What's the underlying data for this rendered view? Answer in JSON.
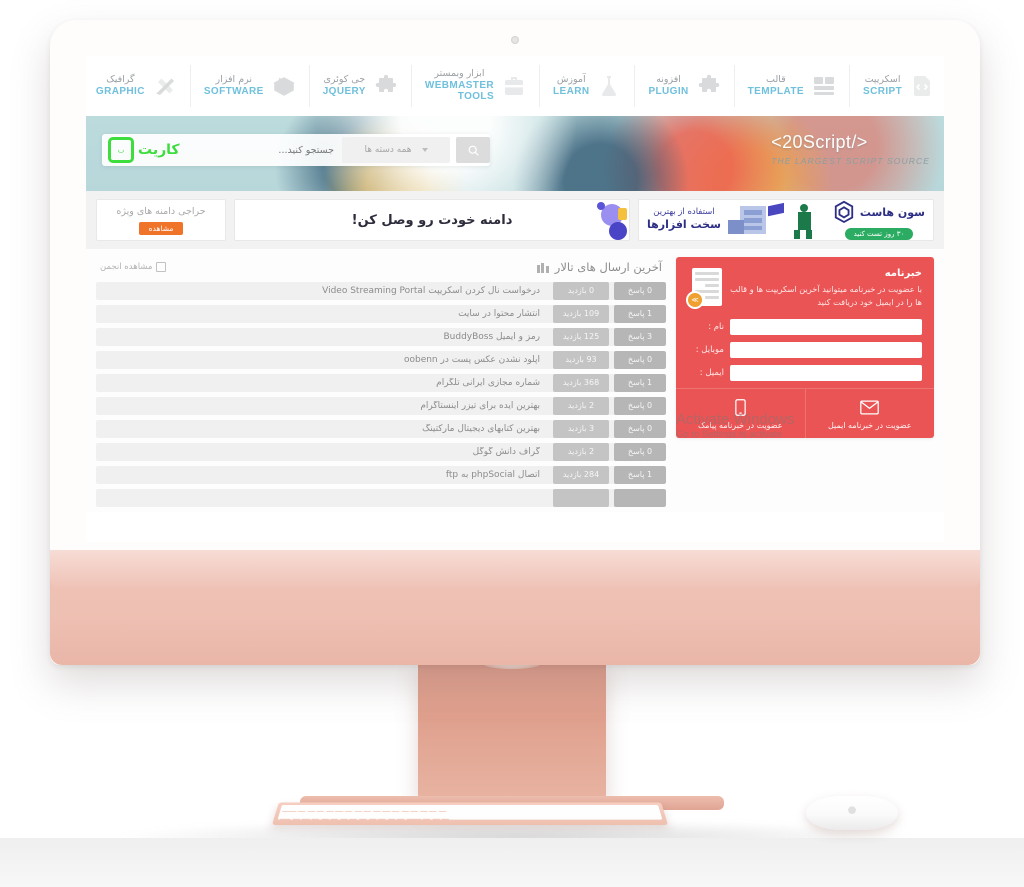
{
  "site": {
    "nav": [
      {
        "fa": "اسکریپت",
        "en": "SCRIPT",
        "icon": "script-icon"
      },
      {
        "fa": "قالب",
        "en": "TEMPLATE",
        "icon": "template-icon"
      },
      {
        "fa": "افزونه",
        "en": "PLUGIN",
        "icon": "plugin-icon"
      },
      {
        "fa": "آموزش",
        "en": "LEARN",
        "icon": "flask-icon"
      },
      {
        "fa": "ابزار وبمستر",
        "en": "WEBMASTER TOOLS",
        "icon": "toolbox-icon"
      },
      {
        "fa": "جی کوئری",
        "en": "JQUERY",
        "icon": "puzzle-icon"
      },
      {
        "fa": "نرم افزار",
        "en": "SOFTWARE",
        "icon": "box-icon"
      },
      {
        "fa": "گرافیک",
        "en": "GRAPHIC",
        "icon": "pencil-ruler-icon"
      }
    ],
    "hero": {
      "title": "<20Script/>",
      "subtitle": "THE LARGEST SCRIPT SOURCE",
      "logo_text": "کاریت",
      "search_placeholder": "جستجو کنید...",
      "category_label": "همه دسته ها"
    },
    "ads": {
      "domain_sale_text": "حراجی دامنه های ویژه",
      "domain_sale_button": "مشاهده",
      "connect_text": "دامنه خودت رو وصل کن!",
      "host_name": "سون هاست",
      "host_button": "۳۰ روز تست کنید",
      "host_line1": "استفاده از بهترین",
      "host_line2": "سخت افزارها"
    },
    "forum": {
      "title": "آخرین ارسال های تالار",
      "view_link": "مشاهده انجمن",
      "views_suffix": "بازدید",
      "replies_suffix": "پاسخ",
      "rows": [
        {
          "title": "درخواست نال کردن اسکریپت Video Streaming Portal",
          "views": "0 بازدید",
          "replies": "0 پاسخ"
        },
        {
          "title": "انتشار محتوا در سایت",
          "views": "109 بازدید",
          "replies": "1 پاسخ"
        },
        {
          "title": "رمز و ایمیل BuddyBoss",
          "views": "125 بازدید",
          "replies": "3 پاسخ"
        },
        {
          "title": "آپلود نشدن عکس پست در oobenn",
          "views": "93 بازدید",
          "replies": "0 پاسخ"
        },
        {
          "title": "شماره مجازی ایرانی تلگرام",
          "views": "368 بازدید",
          "replies": "1 پاسخ"
        },
        {
          "title": "بهترین ایده برای تیزر اینستاگرام",
          "views": "2 بازدید",
          "replies": "0 پاسخ"
        },
        {
          "title": "بهترین کتابهای دیجیتال مارکتینگ",
          "views": "3 بازدید",
          "replies": "0 پاسخ"
        },
        {
          "title": "گراف دانش گوگل",
          "views": "2 بازدید",
          "replies": "0 پاسخ"
        },
        {
          "title": "اتصال phpSocial به ftp",
          "views": "284 بازدید",
          "replies": "1 پاسخ"
        },
        {
          "title": "",
          "views": "",
          "replies": ""
        }
      ]
    },
    "newsletter": {
      "title": "خبرنامه",
      "description": "با عضویت در خبرنامه میتوانید آخرین اسکریپت ها و قالب ها را در ایمیل خود دریافت کنید",
      "fields": [
        {
          "label": "نام :",
          "value": ""
        },
        {
          "label": "موبایل :",
          "value": ""
        },
        {
          "label": "ایمیل :",
          "value": ""
        }
      ],
      "actions": [
        {
          "label": "عضویت در خبرنامه ایمیل",
          "icon": "envelope-icon"
        },
        {
          "label": "عضویت در خبرنامه پیامک",
          "icon": "phone-icon"
        }
      ]
    },
    "watermark": {
      "line1": "Activate Windows",
      "line2": "Go to Settings to activate"
    }
  }
}
